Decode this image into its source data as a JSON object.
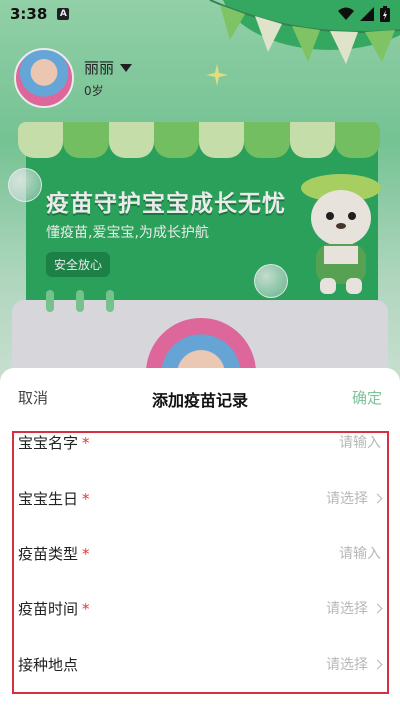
{
  "status_bar": {
    "time": "3:38",
    "notif_icon": "a-icon"
  },
  "profile": {
    "name": "丽丽",
    "age": "0岁"
  },
  "banner": {
    "title": "疫苗守护宝宝成长无忧",
    "subtitle": "懂疫苗,爱宝宝,为成长护航",
    "tag": "安全放心"
  },
  "sheet": {
    "cancel_label": "取消",
    "title": "添加疫苗记录",
    "confirm_label": "确定",
    "confirm_color": "#7ec29a",
    "fields": [
      {
        "label": "宝宝名字",
        "required": "*",
        "value": "请输入",
        "kind": "input"
      },
      {
        "label": "宝宝生日",
        "required": "*",
        "value": "请选择",
        "kind": "select"
      },
      {
        "label": "疫苗类型",
        "required": "*",
        "value": "请输入",
        "kind": "input"
      },
      {
        "label": "疫苗时间",
        "required": "*",
        "value": "请选择",
        "kind": "select"
      },
      {
        "label": "接种地点",
        "required": "",
        "value": "请选择",
        "kind": "select"
      }
    ]
  }
}
